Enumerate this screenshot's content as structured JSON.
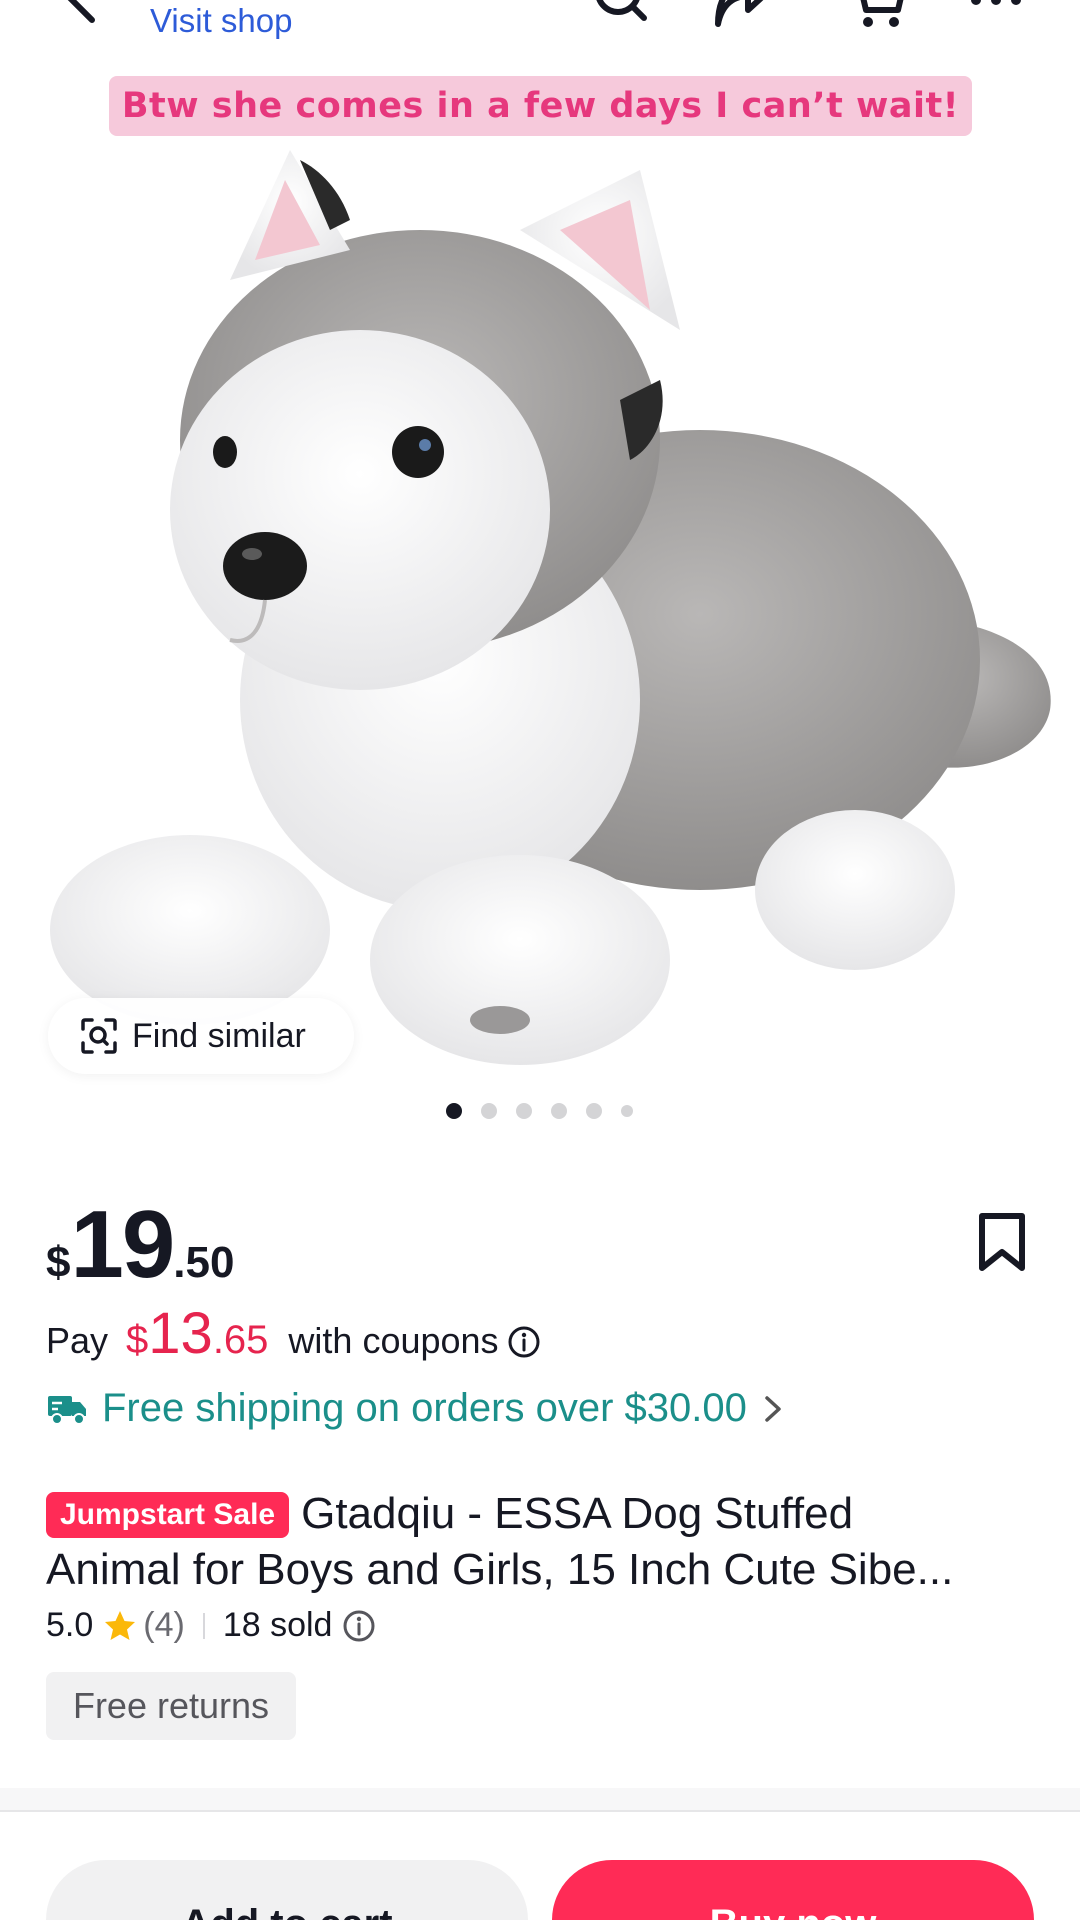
{
  "header": {
    "visit_shop_label": "Visit shop",
    "icons": [
      "back-icon",
      "search-icon",
      "share-icon",
      "cart-icon",
      "more-icon"
    ]
  },
  "caption": {
    "text": "Btw she comes in a few days I can’t wait!"
  },
  "gallery": {
    "find_similar_label": "Find similar",
    "image_count": 6,
    "active_index": 0
  },
  "price": {
    "currency": "$",
    "whole": "19",
    "cents": ".50"
  },
  "coupon": {
    "pay_label": "Pay",
    "currency": "$",
    "whole": "13",
    "cents": ".65",
    "suffix": "with coupons"
  },
  "shipping": {
    "text": "Free shipping on orders over $30.00"
  },
  "product": {
    "badge": "Jumpstart Sale",
    "title_line1": "Gtadqiu - ESSA Dog Stuffed",
    "title_line2": "Animal for Boys and Girls, 15 Inch Cute Sibe..."
  },
  "rating": {
    "score": "5.0",
    "count": "(4)",
    "sold": "18 sold"
  },
  "returns_label": "Free returns",
  "actions": {
    "add_to_cart": "Add to cart",
    "buy_now": "Buy now"
  },
  "colors": {
    "accent": "#ff2b56",
    "coupon_price": "#e6244e",
    "shipping": "#1b8f8a",
    "link": "#2d5bd8",
    "caption_bg": "#f6c9db",
    "caption_text": "#e6387d"
  }
}
